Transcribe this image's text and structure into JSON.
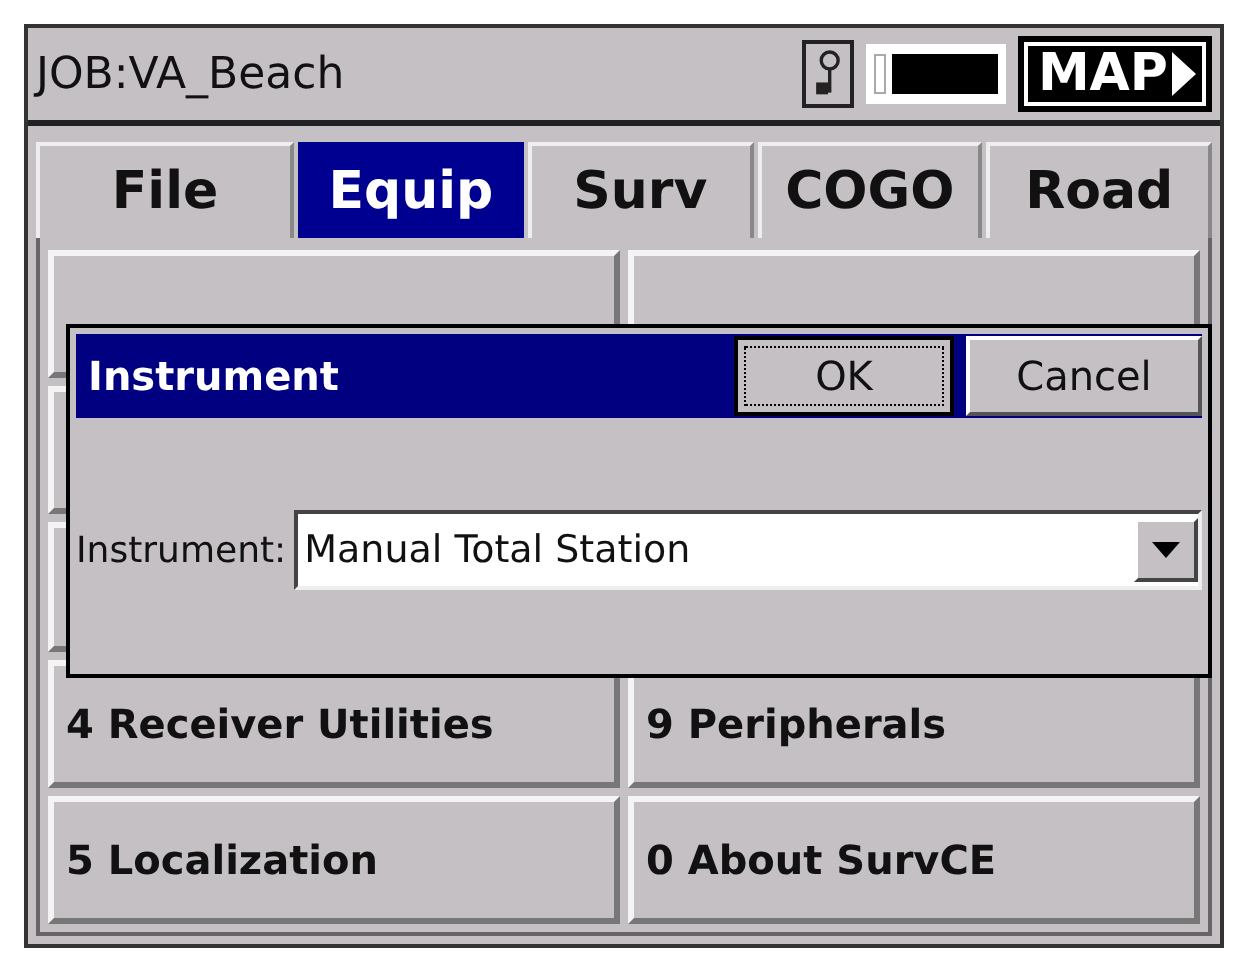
{
  "header": {
    "job": "JOB:VA_Beach",
    "map_button": "MAP"
  },
  "tabs": [
    {
      "label": "File",
      "selected": false
    },
    {
      "label": "Equip",
      "selected": true
    },
    {
      "label": "Surv",
      "selected": false
    },
    {
      "label": "COGO",
      "selected": false
    },
    {
      "label": "Road",
      "selected": false
    }
  ],
  "menu": [
    {
      "label": "4 Receiver Utilities"
    },
    {
      "label": "9 Peripherals"
    },
    {
      "label": "5 Localization"
    },
    {
      "label": "0 About SurvCE"
    }
  ],
  "dialog": {
    "title": "Instrument",
    "ok": "OK",
    "cancel": "Cancel",
    "field_label": "Instrument:",
    "value": "Manual Total Station"
  }
}
